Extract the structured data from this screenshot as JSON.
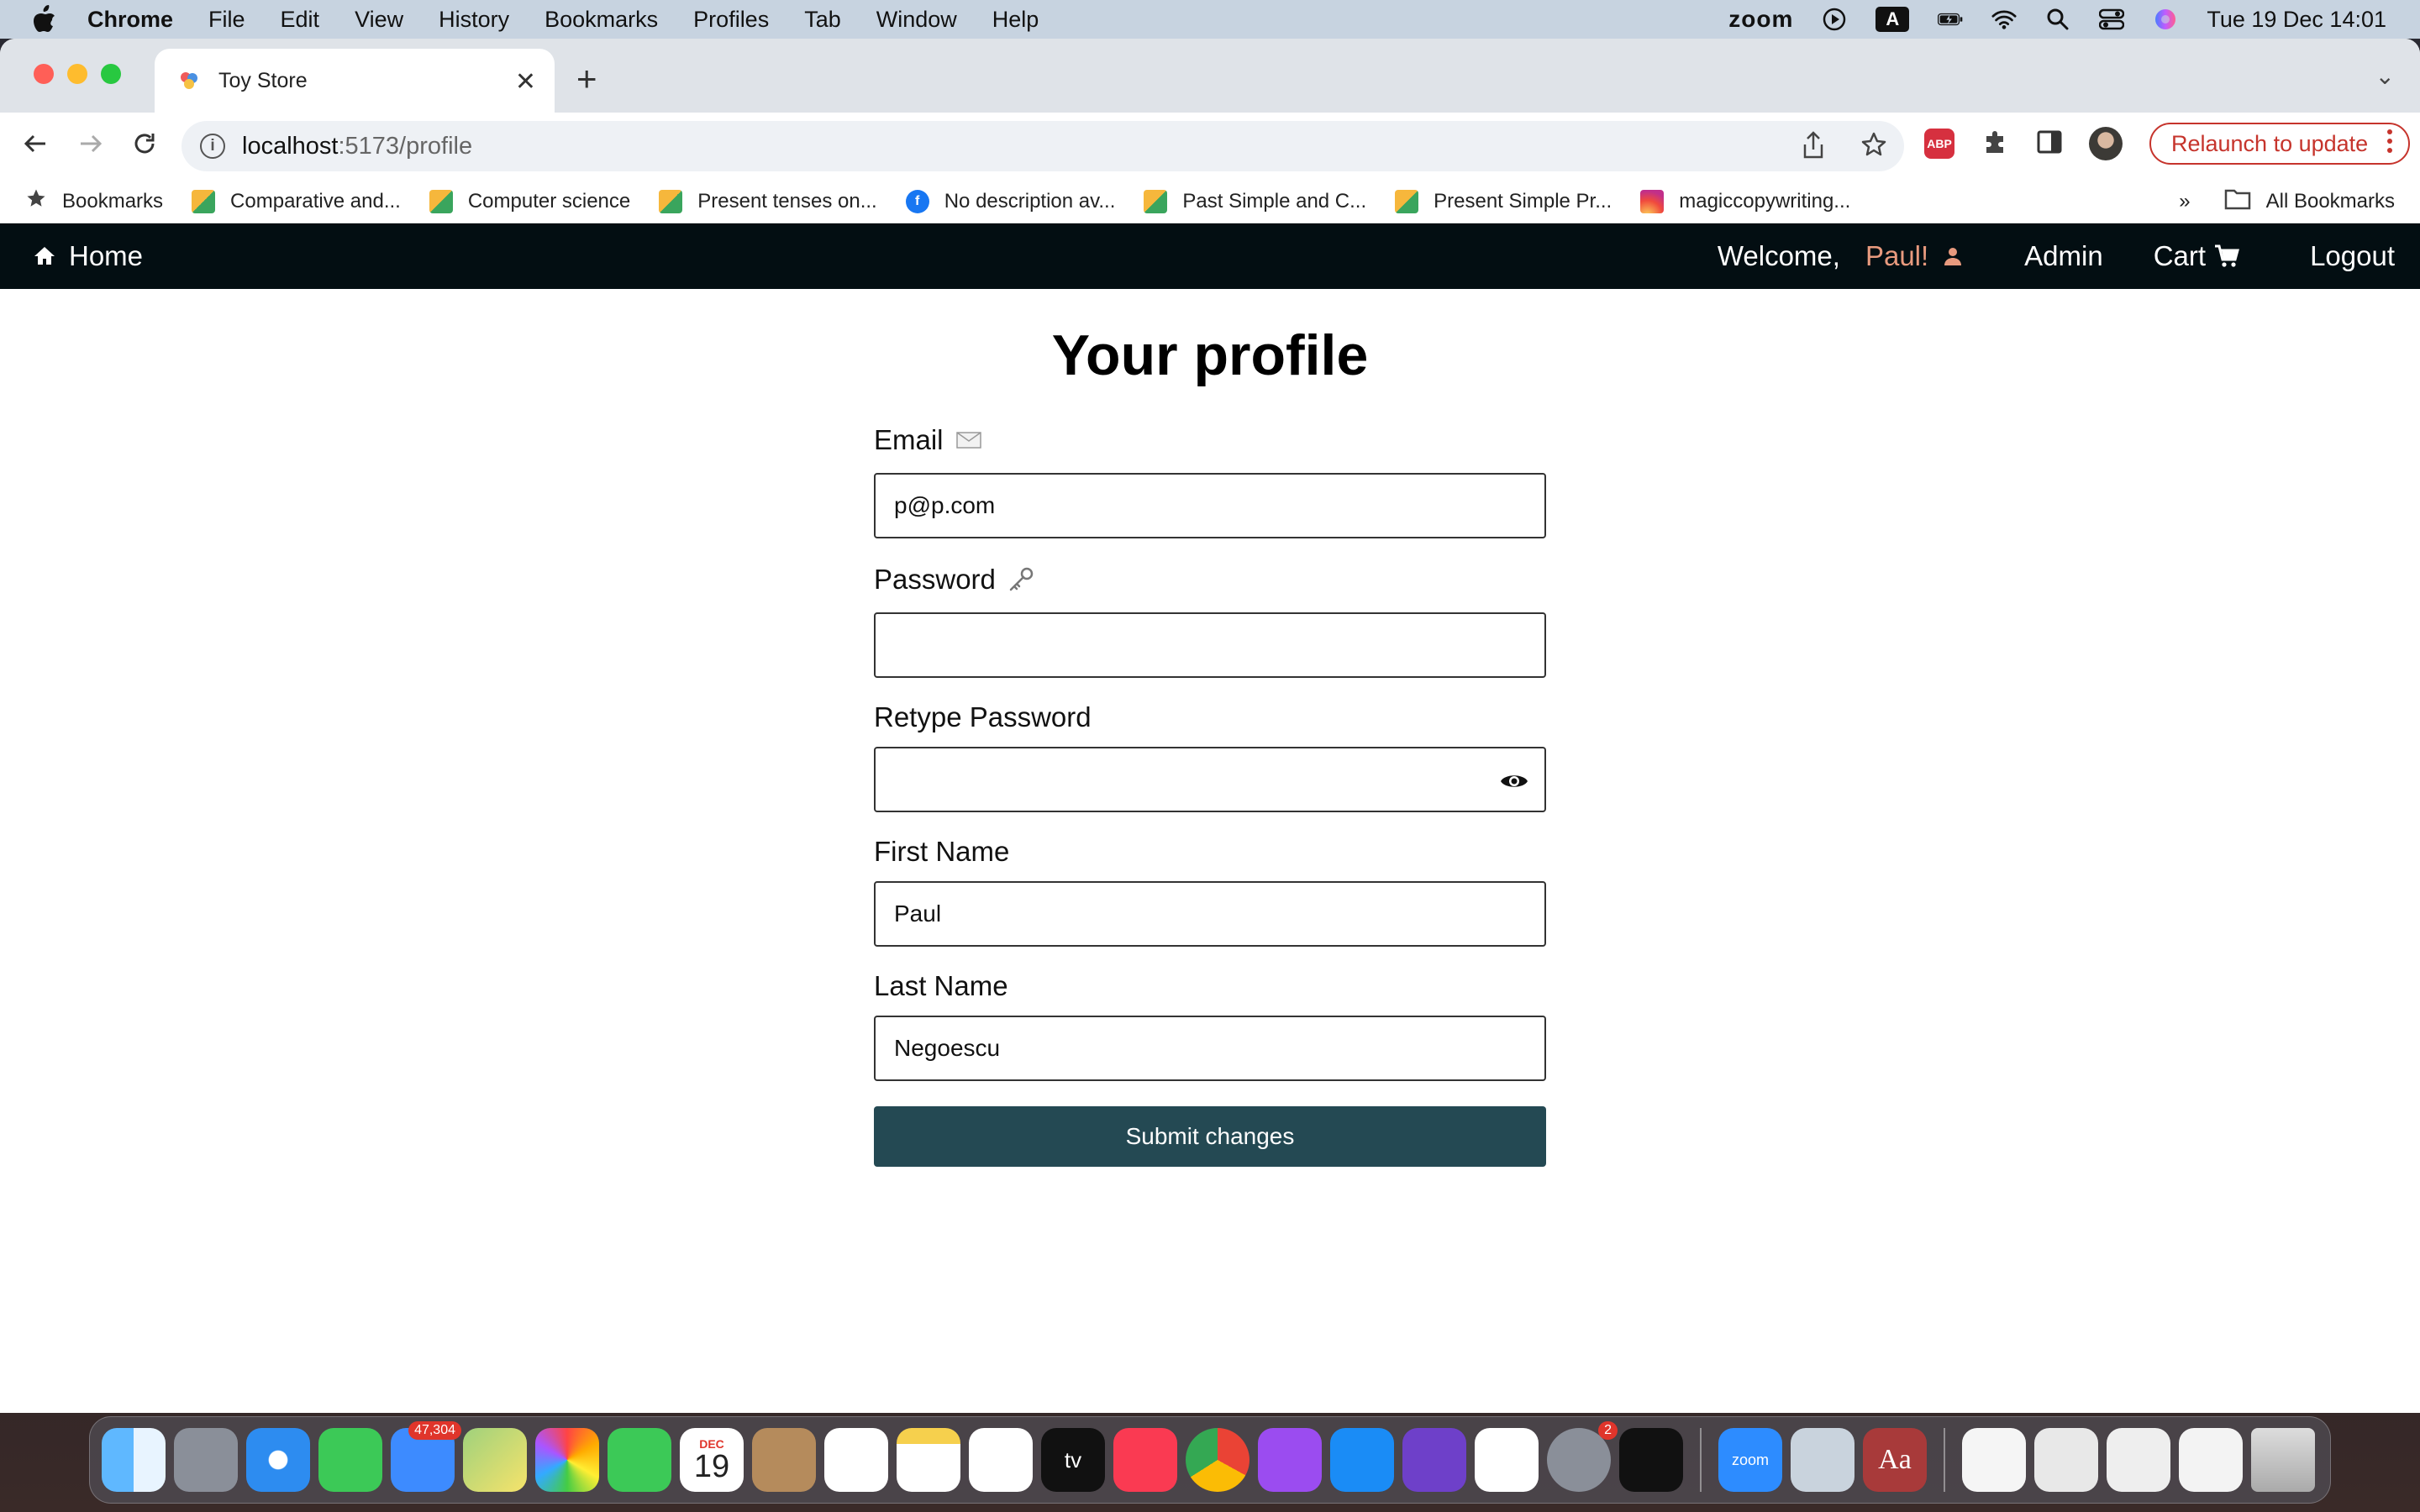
{
  "menubar": {
    "app_name": "Chrome",
    "items": [
      "File",
      "Edit",
      "View",
      "History",
      "Bookmarks",
      "Profiles",
      "Tab",
      "Window",
      "Help"
    ],
    "zoom_label": "zoom",
    "keyboard_label": "A",
    "datetime": "Tue 19 Dec  14:01"
  },
  "browser": {
    "tab_title": "Toy Store",
    "url_host": "localhost",
    "url_path": ":5173/profile",
    "relaunch_label": "Relaunch to update",
    "abp_label": "ABP",
    "bookmarks": [
      {
        "label": "Bookmarks",
        "icon": "star-icon"
      },
      {
        "label": "Comparative and...",
        "icon": "live-icon"
      },
      {
        "label": "Computer science",
        "icon": "live-icon"
      },
      {
        "label": "Present tenses on...",
        "icon": "live-icon"
      },
      {
        "label": "No description av...",
        "icon": "facebook-icon"
      },
      {
        "label": "Past Simple and C...",
        "icon": "live-icon"
      },
      {
        "label": "Present Simple Pr...",
        "icon": "live-icon"
      },
      {
        "label": "magiccopywriting...",
        "icon": "instagram-icon"
      }
    ],
    "bookmarks_overflow": "»",
    "all_bookmarks": "All Bookmarks"
  },
  "navbar": {
    "home": "Home",
    "welcome": "Welcome,",
    "user": "Paul!",
    "admin": "Admin",
    "cart": "Cart",
    "logout": "Logout",
    "user_color": "#e89a7e",
    "bg_color": "#030e12"
  },
  "profile": {
    "title": "Your profile",
    "email_label": "Email",
    "email_value": "p@p.com",
    "password_label": "Password",
    "password_value": "",
    "retype_label": "Retype Password",
    "retype_value": "",
    "first_name_label": "First Name",
    "first_name_value": "Paul",
    "last_name_label": "Last Name",
    "last_name_value": "Negoescu",
    "submit_label": "Submit changes",
    "submit_color": "#244953"
  },
  "dock": {
    "mail_badge": "47,304",
    "calendar_month": "DEC",
    "calendar_day": "19",
    "settings_badge": "2",
    "tv_label": "tv",
    "zoom_label": "zoom",
    "dictionary_label": "Aa"
  }
}
